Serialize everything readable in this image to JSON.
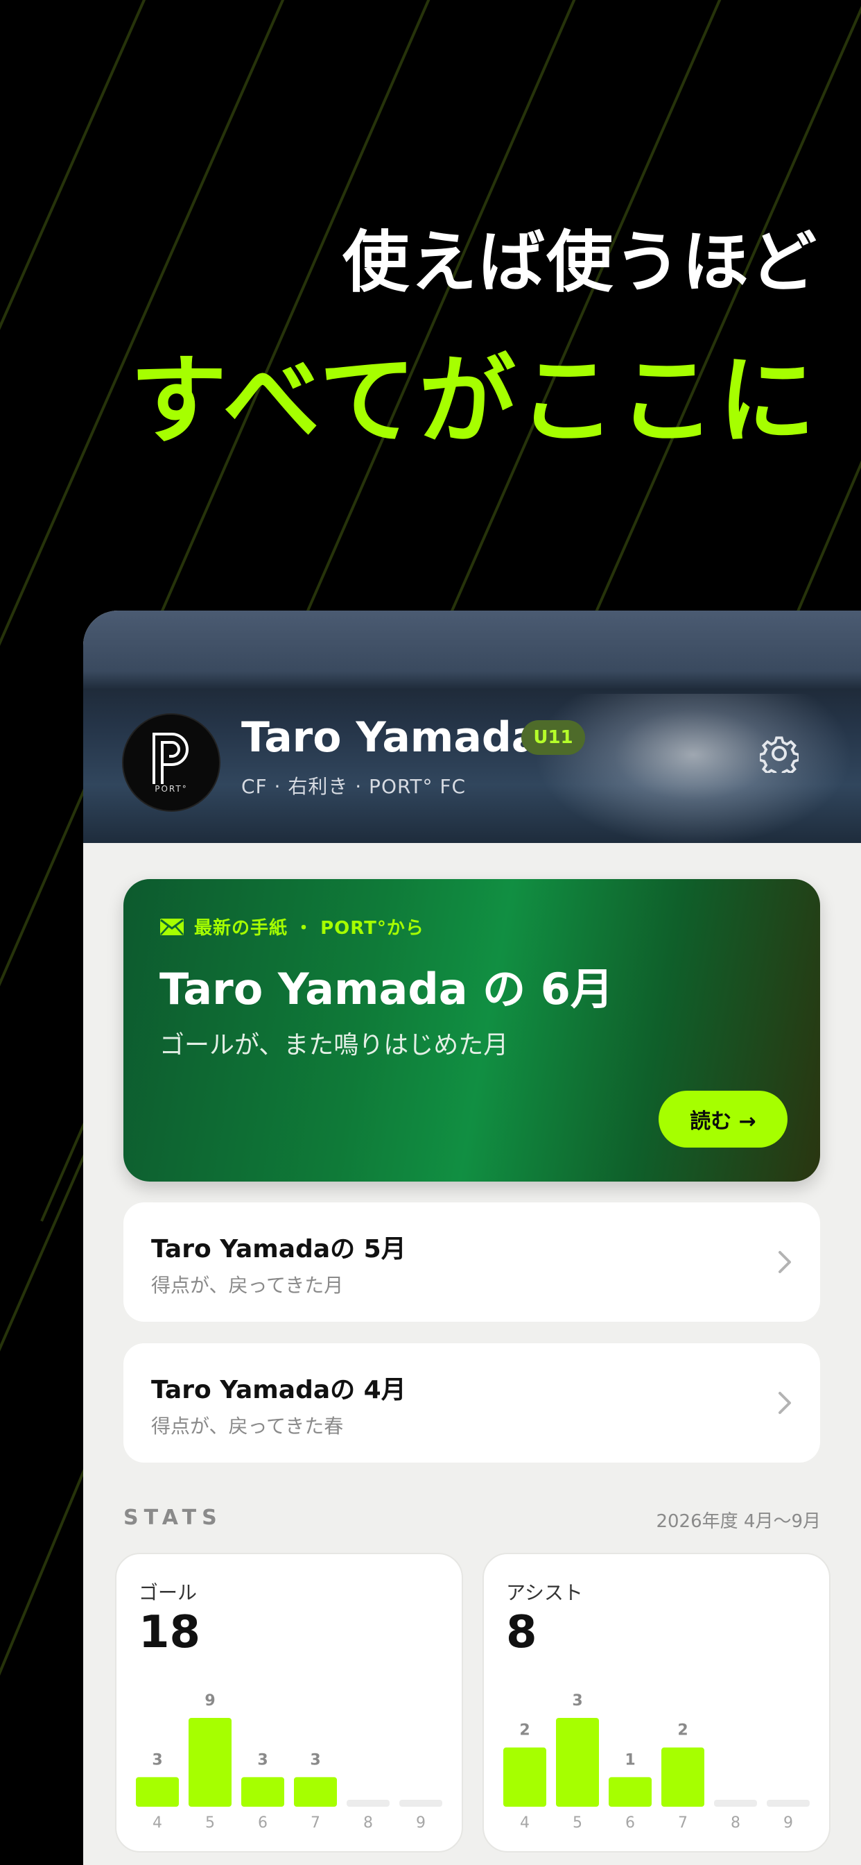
{
  "headline": {
    "line1": "使えば使うほど",
    "line2": "すべてがここに"
  },
  "profile": {
    "name": "Taro Yamada",
    "badge": "U11",
    "subtitle": "CF · 右利き · PORT° FC",
    "logo_text": "PORT°"
  },
  "latest_letter": {
    "tag": "最新の手紙 ・ PORT°から",
    "title": "Taro Yamada の 6月",
    "subtitle": "ゴールが、また鳴りはじめた月",
    "read_button": "読む →"
  },
  "letters": [
    {
      "title": "Taro Yamadaの 5月",
      "subtitle": "得点が、戻ってきた月"
    },
    {
      "title": "Taro Yamadaの 4月",
      "subtitle": "得点が、戻ってきた春"
    }
  ],
  "stats": {
    "label": "STATS",
    "range": "2026年度 4月〜9月",
    "cards": [
      {
        "label": "ゴール",
        "total": "18"
      },
      {
        "label": "アシスト",
        "total": "8"
      }
    ]
  },
  "chart_data": [
    {
      "type": "bar",
      "title": "ゴール",
      "categories": [
        "4",
        "5",
        "6",
        "7",
        "8",
        "9"
      ],
      "values": [
        3,
        9,
        3,
        3,
        0,
        0
      ],
      "highlight": "5"
    },
    {
      "type": "bar",
      "title": "アシスト",
      "categories": [
        "4",
        "5",
        "6",
        "7",
        "8",
        "9"
      ],
      "values": [
        2,
        3,
        1,
        2,
        0,
        0
      ],
      "highlight": "5"
    }
  ],
  "colors": {
    "accent": "#a6ff00",
    "background": "#000000",
    "panel": "#f0f0ee",
    "empty_bar": "#ececec"
  },
  "icons": {
    "mail": "envelope-icon",
    "settings": "gear-icon",
    "chevron": "chevron-right-icon"
  }
}
